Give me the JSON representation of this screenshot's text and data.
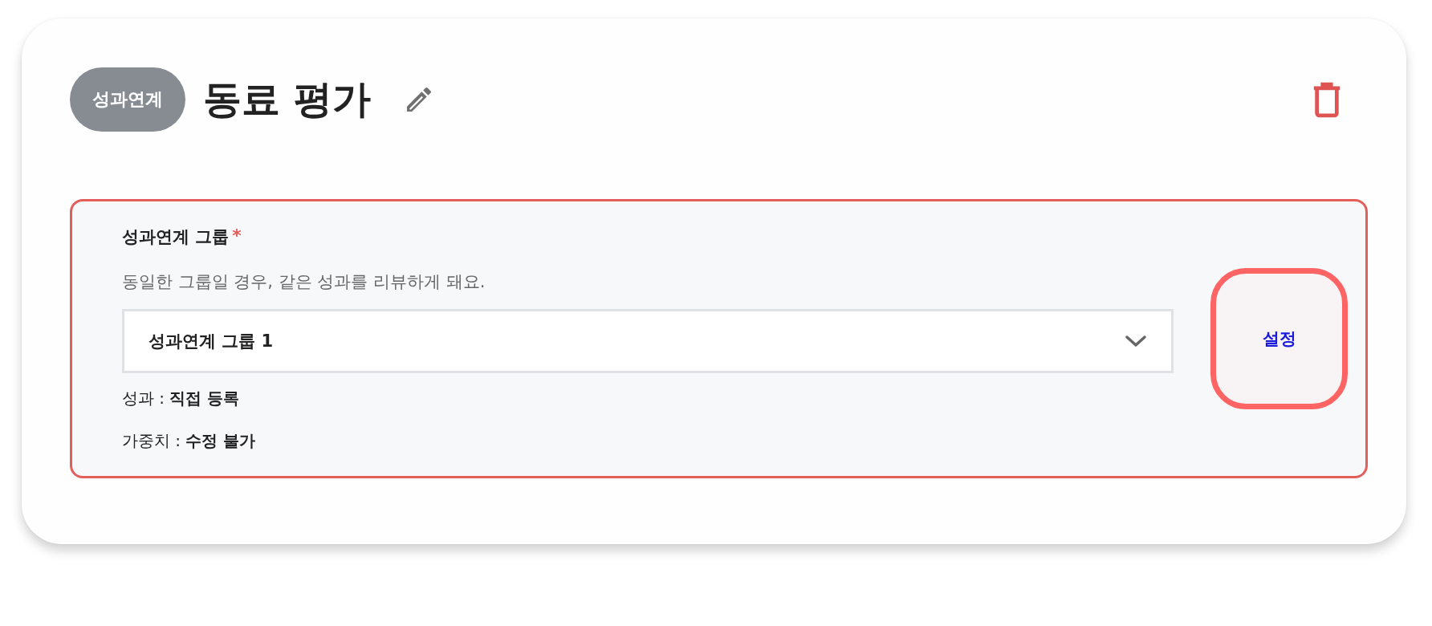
{
  "header": {
    "badge": "성과연계",
    "title": "동료 평가"
  },
  "group_section": {
    "highlighted": true,
    "label": "성과연계 그룹",
    "required_mark": "*",
    "description": "동일한 그룹일 경우, 같은 성과를 리뷰하게 돼요.",
    "value": "성과연계 그룹 1",
    "info_lines": [
      "성과 : **직접 등록**",
      "가중치 : **수정 불가**"
    ],
    "set_button": {
      "label": "설정",
      "highlighted": true
    }
  }
}
